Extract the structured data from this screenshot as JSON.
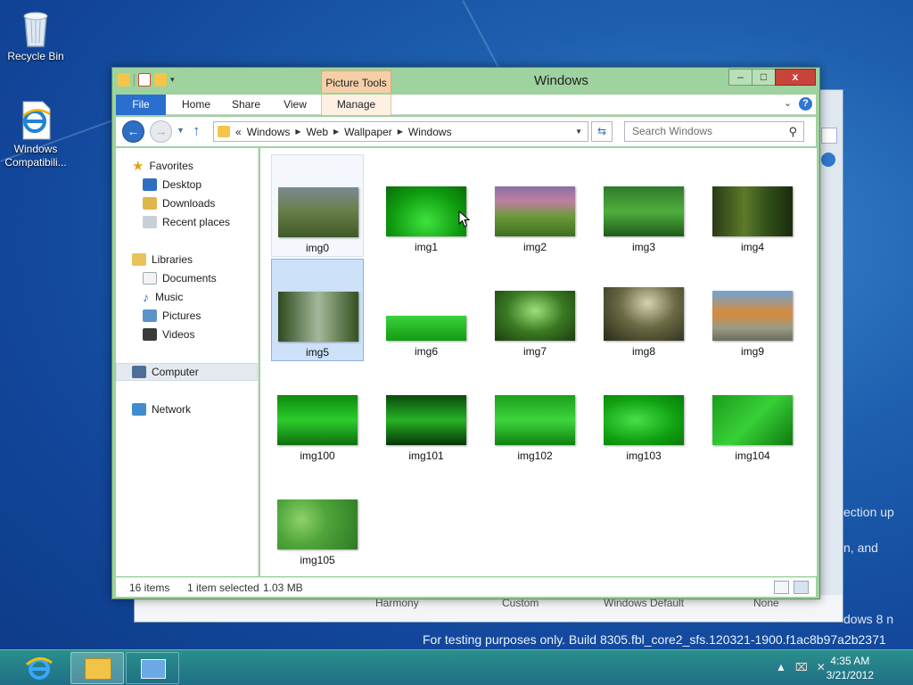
{
  "desktop": {
    "icons": [
      {
        "name": "recycle-bin",
        "label": "Recycle Bin"
      },
      {
        "name": "windows-compat",
        "label": "Windows Compatibili..."
      }
    ],
    "watermark": "For testing purposes only. Build 8305.fbl_core2_sfs.120321-1900.f1ac8b97a2b2371",
    "side_text": [
      "ection up",
      "n, and",
      "dows 8 n"
    ]
  },
  "background_window": {
    "bottom_labels": [
      "Harmony",
      "Custom",
      "Windows Default",
      "None"
    ]
  },
  "window": {
    "title": "Windows",
    "context_tab": "Picture Tools",
    "controls": {
      "minimize": "–",
      "maximize": "□",
      "close": "x"
    },
    "ribbon_tabs": [
      {
        "label": "File"
      },
      {
        "label": "Home"
      },
      {
        "label": "Share"
      },
      {
        "label": "View"
      },
      {
        "label": "Manage"
      }
    ],
    "address": {
      "prefix": "«",
      "crumbs": [
        "Windows",
        "Web",
        "Wallpaper",
        "Windows"
      ]
    },
    "search_placeholder": "Search Windows",
    "nav_pane": {
      "favorites_header": "Favorites",
      "favorites": [
        "Desktop",
        "Downloads",
        "Recent places"
      ],
      "libraries_header": "Libraries",
      "libraries": [
        "Documents",
        "Music",
        "Pictures",
        "Videos"
      ],
      "computer": "Computer",
      "network": "Network"
    },
    "files": [
      {
        "name": "img0",
        "state": "hover"
      },
      {
        "name": "img1"
      },
      {
        "name": "img2"
      },
      {
        "name": "img3"
      },
      {
        "name": "img4"
      },
      {
        "name": "img5",
        "state": "selected"
      },
      {
        "name": "img6"
      },
      {
        "name": "img7"
      },
      {
        "name": "img8"
      },
      {
        "name": "img9"
      },
      {
        "name": "img100"
      },
      {
        "name": "img101"
      },
      {
        "name": "img102"
      },
      {
        "name": "img103"
      },
      {
        "name": "img104"
      },
      {
        "name": "img105"
      }
    ],
    "status": {
      "item_count": "16 items",
      "selection": "1 item selected",
      "size": "1.03 MB"
    }
  },
  "taskbar": {
    "time": "4:35 AM",
    "date": "3/21/2012"
  },
  "colors": {
    "accent": "#2a6fcf",
    "window_frame": "#9ed29e",
    "context_tab": "#f6cfa8",
    "selection": "#cde1f8"
  }
}
